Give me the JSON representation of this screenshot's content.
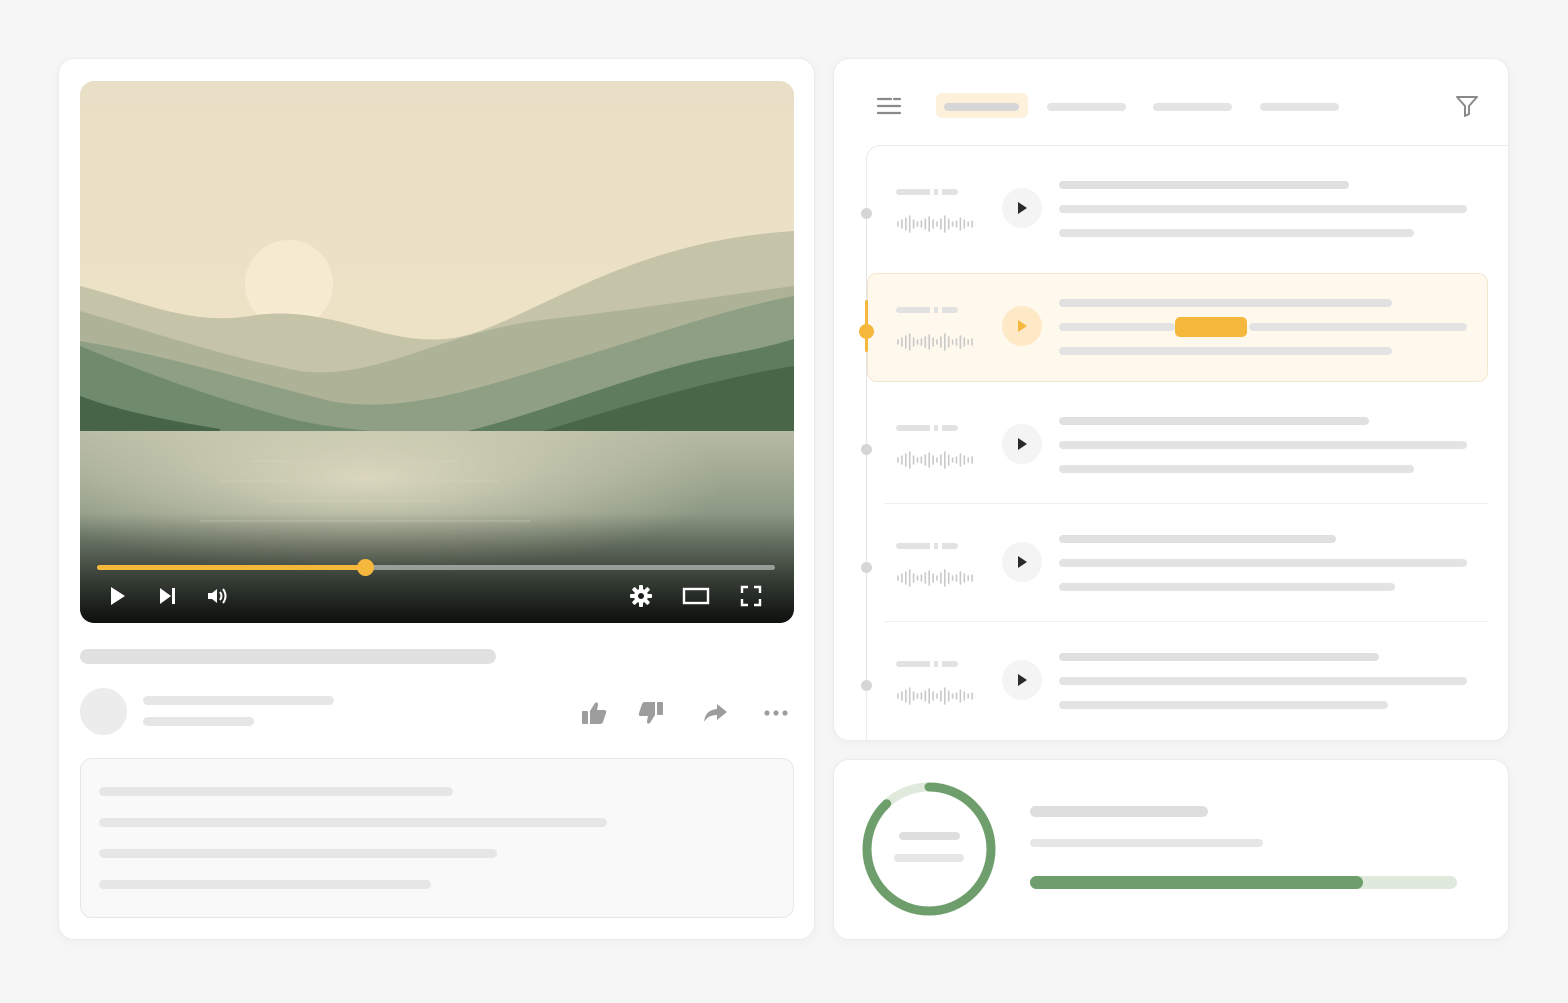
{
  "colors": {
    "accent": "#f5b83d",
    "accent_soft": "#fde9c6",
    "success": "#6e9e6c",
    "success_soft": "#dfeadc",
    "skeleton": "#dedede"
  },
  "player": {
    "progress": 0.395,
    "controls": [
      "play-icon",
      "skip-next-icon",
      "volume-icon",
      "settings-icon",
      "theater-mode-icon",
      "fullscreen-icon"
    ]
  },
  "actions": [
    "thumbs-up-icon",
    "thumbs-down-icon",
    "share-icon",
    "more-horizontal-icon"
  ],
  "queue": {
    "tab_count": 4,
    "active_tab": 0,
    "active_item": 1,
    "item_count": 5,
    "toolbar_icons": [
      "list-icon",
      "filter-icon"
    ]
  },
  "stats": {
    "ring_progress": 0.88,
    "bar_progress": 0.78
  }
}
